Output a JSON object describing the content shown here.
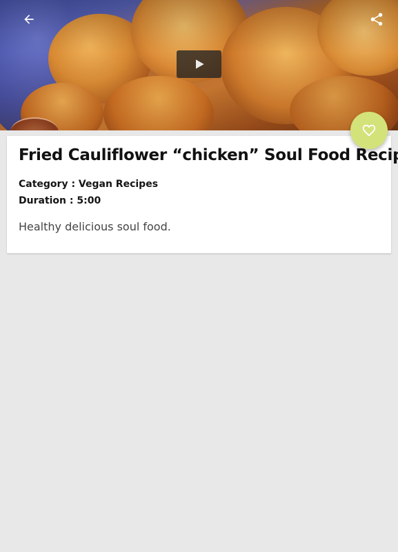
{
  "hero": {
    "image_alt": "Fried cauliflower chicken pieces",
    "back_icon": "arrow-left-icon",
    "share_icon": "share-icon",
    "play_icon": "play-icon"
  },
  "recipe": {
    "title": "Fried Cauliflower “chicken” Soul Food Recipe",
    "category": "Category : Vegan Recipes",
    "duration": "Duration : 5:00",
    "description": "Healthy delicious soul food."
  },
  "favorite": {
    "icon": "heart-outline-icon",
    "color": "#d4e27a"
  },
  "colors": {
    "background": "#e8e8e8",
    "card": "#ffffff",
    "title_text": "#111111",
    "description_text": "#444444"
  }
}
